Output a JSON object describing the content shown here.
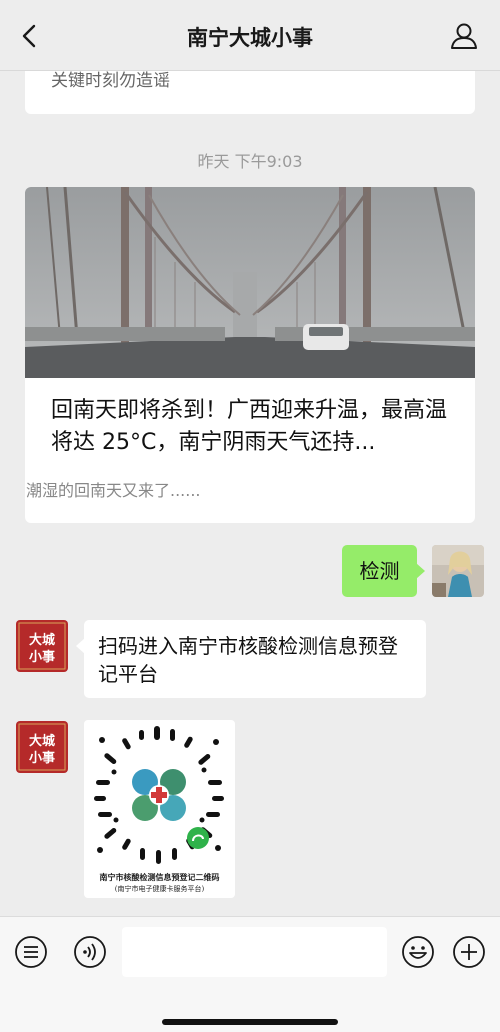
{
  "header": {
    "title": "南宁大城小事",
    "back_icon": "chevron-left-icon",
    "profile_icon": "user-icon"
  },
  "top_card": {
    "snippet": "关键时刻勿造谣"
  },
  "timestamp": "昨天 下午9:03",
  "article": {
    "title": "回南天即将杀到！广西迎来升温，最高温将达 25°C，南宁阴雨天气还持...",
    "description": "潮湿的回南天又来了......"
  },
  "messages": {
    "me": "检测",
    "bot_text": "扫码进入南宁市核酸检测信息预登记平台"
  },
  "bot_avatar": {
    "line1": "大城",
    "line2": "小事"
  },
  "qr": {
    "caption_line1": "南宁市核酸检测信息预登记二维码",
    "caption_line2": "(南宁市电子健康卡服务平台)"
  },
  "input_bar": {
    "left_icons": [
      "list-icon",
      "voice-icon"
    ],
    "right_icons": [
      "emoji-icon",
      "plus-icon"
    ]
  },
  "colors": {
    "background": "#ededed",
    "my_bubble": "#95ec69",
    "avatar_red": "#b52a2a"
  }
}
